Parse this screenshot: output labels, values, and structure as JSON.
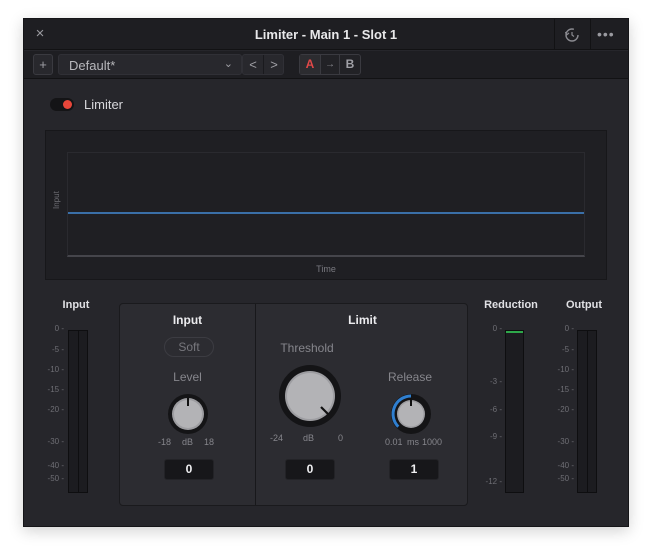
{
  "window": {
    "title": "Limiter - Main 1 -  Slot 1",
    "close_icon": "×",
    "more_icon": "•••"
  },
  "toolbar": {
    "add_label": "+",
    "preset": "Default*",
    "preset_chevron": "⌄",
    "prev_label": "<",
    "next_label": ">",
    "ab_a": "A",
    "ab_arrow": "→",
    "ab_b": "B"
  },
  "enable": {
    "label": "Limiter",
    "on": true,
    "color": "#e8463a"
  },
  "graph": {
    "ylabel": "Input",
    "xlabel": "Time",
    "line_level_fraction": 0.58,
    "line_color": "#3a6fa8"
  },
  "meters": {
    "input": {
      "title": "Input",
      "ticks": [
        "0",
        "-5",
        "-10",
        "-15",
        "-20",
        "-30",
        "-40",
        "-50"
      ]
    },
    "reduction": {
      "title": "Reduction",
      "ticks": [
        "0",
        "-3",
        "-6",
        "-9",
        "-12"
      ],
      "level_db": 0,
      "color": "#2ea84a"
    },
    "output": {
      "title": "Output",
      "ticks": [
        "0",
        "-5",
        "-10",
        "-15",
        "-20",
        "-30",
        "-40",
        "-50"
      ]
    }
  },
  "input_section": {
    "title": "Input",
    "soft_label": "Soft",
    "level": {
      "label": "Level",
      "min": "-18",
      "unit": "dB",
      "max": "18",
      "value": "0"
    }
  },
  "limit_section": {
    "title": "Limit",
    "threshold": {
      "label": "Threshold",
      "min": "-24",
      "unit": "dB",
      "max": "0",
      "value": "0"
    },
    "release": {
      "label": "Release",
      "min": "0.01",
      "unit": "ms",
      "max": "1000",
      "value": "1",
      "accent": "#2f7fd0"
    }
  }
}
